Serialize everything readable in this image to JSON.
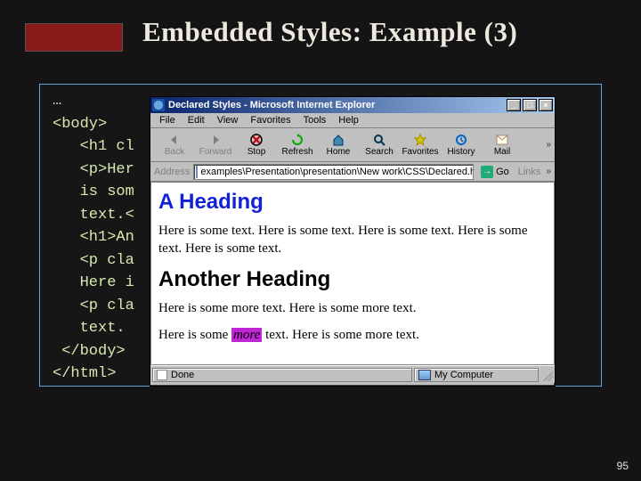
{
  "slide": {
    "title": "Embedded Styles: Example (3)",
    "page_number": "95"
  },
  "code": "…\n<body>\n   <h1 cl\n   <p>Her\n   is som\n   text.<\n   <h1>An\n   <p cla\n   Here i\n   <p cla\n   text.\n </body>\n</html>",
  "ie": {
    "title": "Declared Styles - Microsoft Internet Explorer",
    "menus": [
      "File",
      "Edit",
      "View",
      "Favorites",
      "Tools",
      "Help"
    ],
    "toolbar": {
      "back": "Back",
      "forward": "Forward",
      "stop": "Stop",
      "refresh": "Refresh",
      "home": "Home",
      "search": "Search",
      "favorites": "Favorites",
      "history": "History",
      "mail": "Mail"
    },
    "address_label": "Address",
    "address": "examples\\Presentation\\presentation\\New work\\CSS\\Declared.html",
    "go_label": "Go",
    "links_label": "Links",
    "status_done": "Done",
    "status_zone": "My Computer"
  },
  "page": {
    "h1a": "A Heading",
    "p1": "Here is some text. Here is some text. Here is some text. Here is some text. Here is some text.",
    "h1b": "Another Heading",
    "p2": "Here is some more text. Here is some more text.",
    "p3a": "Here is some ",
    "p3_em": "more",
    "p3b": " text. Here is some more text."
  }
}
